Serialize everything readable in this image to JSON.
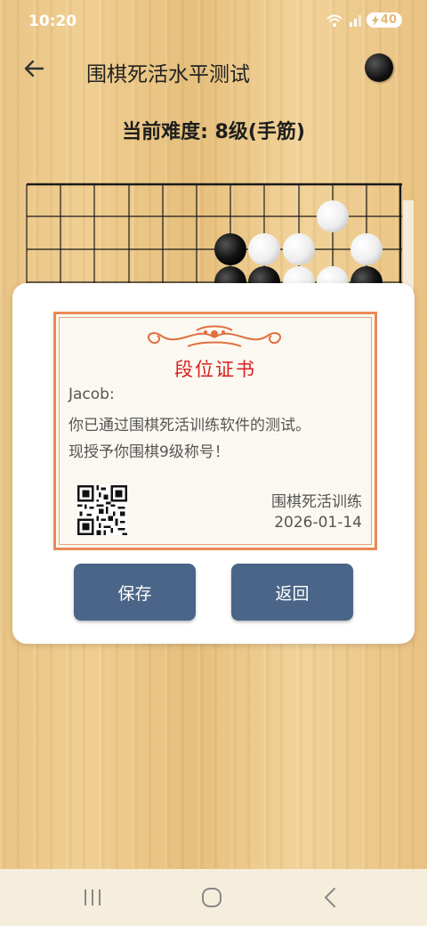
{
  "status": {
    "time": "10:20",
    "battery": "40"
  },
  "header": {
    "title": "围棋死活水平测试",
    "back_icon": "arrow-left-icon",
    "stone_icon": "black-stone-icon"
  },
  "difficulty_label": "当前难度: 8级(手筋)",
  "certificate": {
    "title": "段位证书",
    "recipient": "Jacob:",
    "line1": "你已通过围棋死活训练软件的测试。",
    "line2": "现授予你围棋9级称号！",
    "issuer": "围棋死活训练",
    "date": "2026-01-14",
    "border_color": "#e88a55",
    "title_color": "#d91e1e"
  },
  "buttons": {
    "save": "保存",
    "back": "返回",
    "color": "#4a6587"
  },
  "nav": {
    "recents": "recents-icon",
    "home": "home-icon",
    "back": "back-icon"
  }
}
